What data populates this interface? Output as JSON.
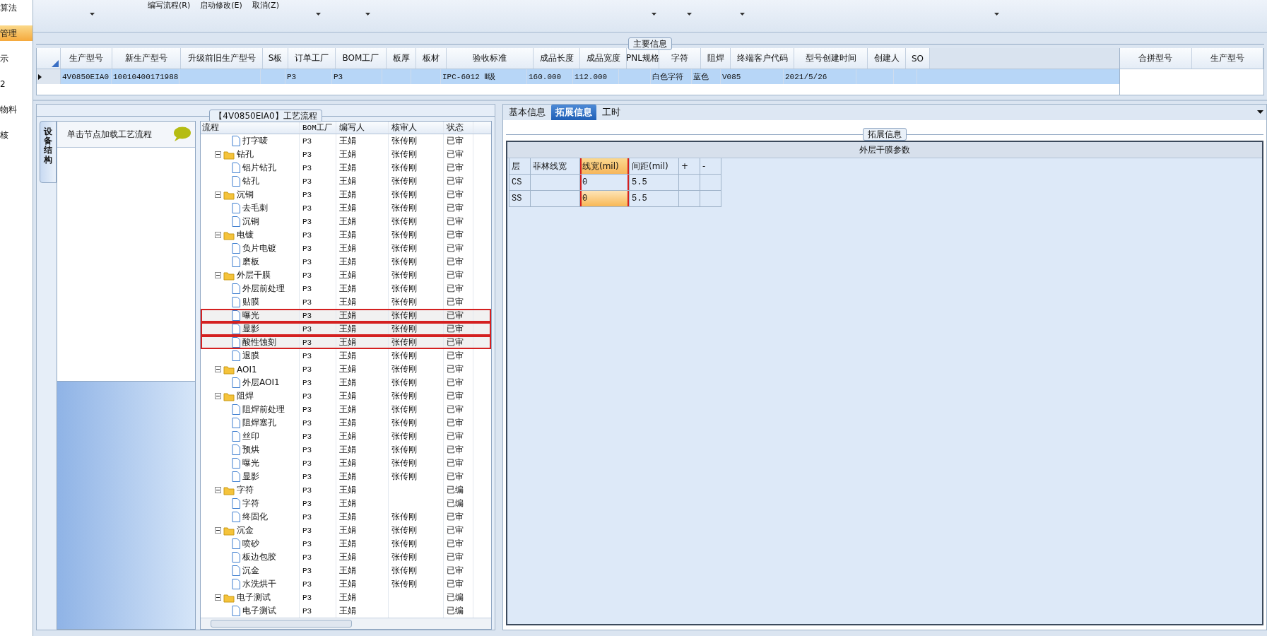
{
  "sidebar": {
    "items": [
      {
        "label": "算法",
        "selected": false
      },
      {
        "label": "管理",
        "selected": true
      },
      {
        "label": "示",
        "selected": false
      },
      {
        "label": "2",
        "selected": false
      },
      {
        "label": "物料",
        "selected": false
      },
      {
        "label": "核",
        "selected": false
      }
    ]
  },
  "toolbar": {
    "commands": [
      {
        "label": "编写流程(R)"
      },
      {
        "label": "启动修改(E)"
      },
      {
        "label": "取消(Z)"
      }
    ]
  },
  "main_info": {
    "title": "主要信息",
    "columns": [
      "生产型号",
      "新生产型号",
      "升级前旧生产型号",
      "S板",
      "订单工厂",
      "BOM工厂",
      "板厚",
      "板材",
      "验收标准",
      "成品长度",
      "成品宽度",
      "PNL规格",
      "字符",
      "阻焊",
      "终端客户代码",
      "型号创建时间",
      "创建人",
      "SO"
    ],
    "rows": [
      {
        "selected": true,
        "cells": [
          "4V0850EIA0",
          "10010400171988",
          null,
          null,
          "P3",
          "P3",
          null,
          null,
          "IPC-6012 Ⅱ级",
          "160.000",
          "112.000",
          null,
          "白色字符",
          "蓝色",
          "V085",
          "2021/5/26",
          null,
          null
        ]
      }
    ],
    "side_columns": [
      "合拼型号",
      "生产型号"
    ]
  },
  "process": {
    "title": "【4V0850EIA0】工艺流程",
    "side_tab": "设备结构",
    "hint": "单击节点加载工艺流程",
    "columns": [
      "流程",
      "BOM工厂",
      "编写人",
      "核审人",
      "状态"
    ],
    "tree": [
      {
        "label": "打字唛",
        "kind": "step",
        "bom": "P3",
        "writer": "王娟",
        "reviewer": "张传刚",
        "status": "已审",
        "boxed": false
      },
      {
        "label": "钻孔",
        "kind": "folder",
        "bom": "P3",
        "writer": "王娟",
        "reviewer": "张传刚",
        "status": "已审",
        "boxed": false,
        "children": [
          {
            "label": "铝片钻孔",
            "kind": "step",
            "bom": "P3",
            "writer": "王娟",
            "reviewer": "张传刚",
            "status": "已审",
            "boxed": false
          },
          {
            "label": "钻孔",
            "kind": "step",
            "bom": "P3",
            "writer": "王娟",
            "reviewer": "张传刚",
            "status": "已审",
            "boxed": false
          }
        ]
      },
      {
        "label": "沉铜",
        "kind": "folder",
        "bom": "P3",
        "writer": "王娟",
        "reviewer": "张传刚",
        "status": "已审",
        "boxed": false,
        "children": [
          {
            "label": "去毛刺",
            "kind": "step",
            "bom": "P3",
            "writer": "王娟",
            "reviewer": "张传刚",
            "status": "已审",
            "boxed": false
          },
          {
            "label": "沉铜",
            "kind": "step",
            "bom": "P3",
            "writer": "王娟",
            "reviewer": "张传刚",
            "status": "已审",
            "boxed": false
          }
        ]
      },
      {
        "label": "电镀",
        "kind": "folder",
        "bom": "P3",
        "writer": "王娟",
        "reviewer": "张传刚",
        "status": "已审",
        "boxed": false,
        "children": [
          {
            "label": "负片电镀",
            "kind": "step",
            "bom": "P3",
            "writer": "王娟",
            "reviewer": "张传刚",
            "status": "已审",
            "boxed": false
          },
          {
            "label": "磨板",
            "kind": "step",
            "bom": "P3",
            "writer": "王娟",
            "reviewer": "张传刚",
            "status": "已审",
            "boxed": false
          }
        ]
      },
      {
        "label": "外层干膜",
        "kind": "folder",
        "bom": "P3",
        "writer": "王娟",
        "reviewer": "张传刚",
        "status": "已审",
        "boxed": false,
        "children": [
          {
            "label": "外层前处理",
            "kind": "step",
            "bom": "P3",
            "writer": "王娟",
            "reviewer": "张传刚",
            "status": "已审",
            "boxed": false
          },
          {
            "label": "贴膜",
            "kind": "step",
            "bom": "P3",
            "writer": "王娟",
            "reviewer": "张传刚",
            "status": "已审",
            "boxed": false
          },
          {
            "label": "曝光",
            "kind": "step",
            "bom": "P3",
            "writer": "王娟",
            "reviewer": "张传刚",
            "status": "已审",
            "boxed": true
          },
          {
            "label": "显影",
            "kind": "step",
            "bom": "P3",
            "writer": "王娟",
            "reviewer": "张传刚",
            "status": "已审",
            "boxed": true
          },
          {
            "label": "酸性蚀刻",
            "kind": "step",
            "bom": "P3",
            "writer": "王娟",
            "reviewer": "张传刚",
            "status": "已审",
            "boxed": true
          },
          {
            "label": "退膜",
            "kind": "step",
            "bom": "P3",
            "writer": "王娟",
            "reviewer": "张传刚",
            "status": "已审",
            "boxed": false
          }
        ]
      },
      {
        "label": "AOI1",
        "kind": "folder",
        "bom": "P3",
        "writer": "王娟",
        "reviewer": "张传刚",
        "status": "已审",
        "boxed": false,
        "children": [
          {
            "label": "外层AOI1",
            "kind": "step",
            "bom": "P3",
            "writer": "王娟",
            "reviewer": "张传刚",
            "status": "已审",
            "boxed": false
          }
        ]
      },
      {
        "label": "阻焊",
        "kind": "folder",
        "bom": "P3",
        "writer": "王娟",
        "reviewer": "张传刚",
        "status": "已审",
        "boxed": false,
        "children": [
          {
            "label": "阻焊前处理",
            "kind": "step",
            "bom": "P3",
            "writer": "王娟",
            "reviewer": "张传刚",
            "status": "已审",
            "boxed": false
          },
          {
            "label": "阻焊塞孔",
            "kind": "step",
            "bom": "P3",
            "writer": "王娟",
            "reviewer": "张传刚",
            "status": "已审",
            "boxed": false
          },
          {
            "label": "丝印",
            "kind": "step",
            "bom": "P3",
            "writer": "王娟",
            "reviewer": "张传刚",
            "status": "已审",
            "boxed": false
          },
          {
            "label": "预烘",
            "kind": "step",
            "bom": "P3",
            "writer": "王娟",
            "reviewer": "张传刚",
            "status": "已审",
            "boxed": false
          },
          {
            "label": "曝光",
            "kind": "step",
            "bom": "P3",
            "writer": "王娟",
            "reviewer": "张传刚",
            "status": "已审",
            "boxed": false
          },
          {
            "label": "显影",
            "kind": "step",
            "bom": "P3",
            "writer": "王娟",
            "reviewer": "张传刚",
            "status": "已审",
            "boxed": false
          }
        ]
      },
      {
        "label": "字符",
        "kind": "folder",
        "bom": "P3",
        "writer": "王娟",
        "status": "已编",
        "boxed": false,
        "children": [
          {
            "label": "字符",
            "kind": "step",
            "bom": "P3",
            "writer": "王娟",
            "status": "已编",
            "boxed": false
          },
          {
            "label": "终固化",
            "kind": "step",
            "bom": "P3",
            "writer": "王娟",
            "reviewer": "张传刚",
            "status": "已审",
            "boxed": false
          }
        ]
      },
      {
        "label": "沉金",
        "kind": "folder",
        "bom": "P3",
        "writer": "王娟",
        "reviewer": "张传刚",
        "status": "已审",
        "boxed": false,
        "children": [
          {
            "label": "喷砂",
            "kind": "step",
            "bom": "P3",
            "writer": "王娟",
            "reviewer": "张传刚",
            "status": "已审",
            "boxed": false
          },
          {
            "label": "板边包胶",
            "kind": "step",
            "bom": "P3",
            "writer": "王娟",
            "reviewer": "张传刚",
            "status": "已审",
            "boxed": false
          },
          {
            "label": "沉金",
            "kind": "step",
            "bom": "P3",
            "writer": "王娟",
            "reviewer": "张传刚",
            "status": "已审",
            "boxed": false
          },
          {
            "label": "水洗烘干",
            "kind": "step",
            "bom": "P3",
            "writer": "王娟",
            "reviewer": "张传刚",
            "status": "已审",
            "boxed": false
          }
        ]
      },
      {
        "label": "电子测试",
        "kind": "folder",
        "bom": "P3",
        "writer": "王娟",
        "status": "已编",
        "boxed": false,
        "children": [
          {
            "label": "电子测试",
            "kind": "step",
            "bom": "P3",
            "writer": "王娟",
            "status": "已编",
            "boxed": false
          }
        ]
      }
    ]
  },
  "detail": {
    "tabs": [
      {
        "label": "基本信息",
        "selected": false
      },
      {
        "label": "拓展信息",
        "selected": true
      },
      {
        "label": "工时",
        "selected": false
      }
    ],
    "group_title": "拓展信息",
    "table": {
      "title": "外层干膜参数",
      "columns": [
        {
          "label": "层",
          "selected": false,
          "boxed": false
        },
        {
          "label": "菲林线宽",
          "selected": false,
          "boxed": false
        },
        {
          "label": "线宽(mil)",
          "selected": true,
          "boxed": true
        },
        {
          "label": "间距(mil)",
          "selected": false,
          "boxed": false
        },
        {
          "label": "+",
          "selected": false,
          "boxed": false
        },
        {
          "label": "-",
          "selected": false,
          "boxed": false
        }
      ],
      "rows": [
        {
          "cells": [
            {
              "text": "CS",
              "selected": false
            },
            {
              "text": null,
              "selected": false
            },
            {
              "text": "0",
              "selected": false
            },
            {
              "text": "5.5",
              "selected": false
            },
            {
              "text": null,
              "selected": false
            },
            {
              "text": null,
              "selected": false
            }
          ]
        },
        {
          "cells": [
            {
              "text": "SS",
              "selected": false
            },
            {
              "text": null,
              "selected": false
            },
            {
              "text": "0",
              "selected": true
            },
            {
              "text": "5.5",
              "selected": false
            },
            {
              "text": null,
              "selected": false
            },
            {
              "text": null,
              "selected": false
            }
          ]
        }
      ]
    }
  }
}
